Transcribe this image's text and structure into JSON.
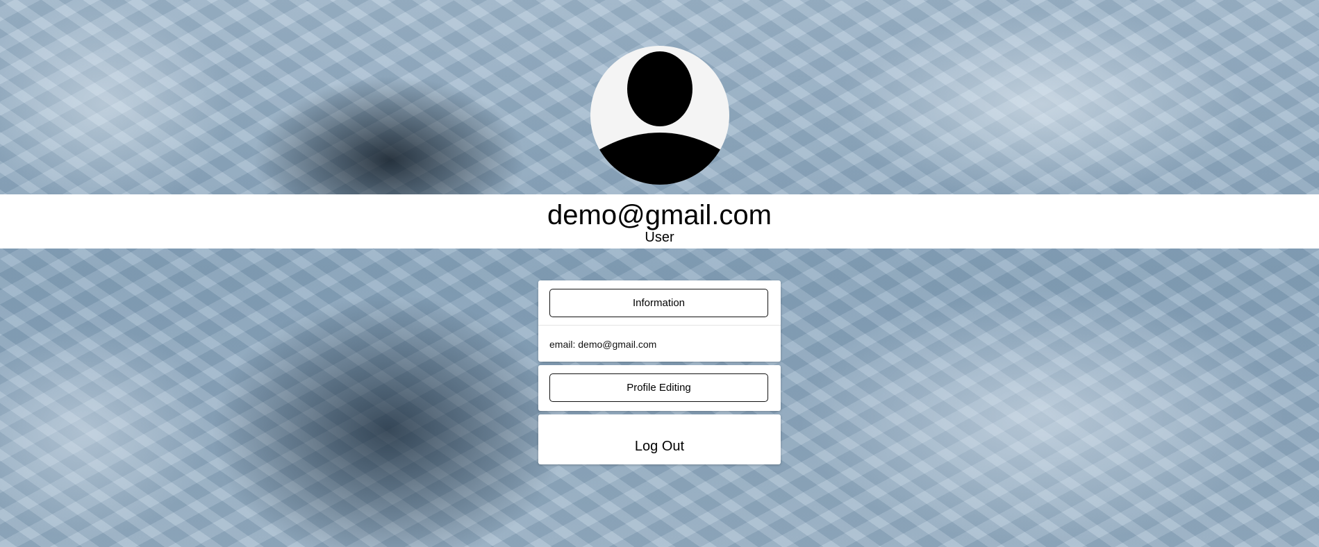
{
  "profile": {
    "email": "demo@gmail.com",
    "role": "User",
    "avatar_icon": "user-silhouette-icon"
  },
  "information": {
    "button_label": "Information",
    "email_label": "email:",
    "email_value": "demo@gmail.com"
  },
  "profile_editing": {
    "button_label": "Profile Editing"
  },
  "logout": {
    "label": "Log Out"
  },
  "colors": {
    "card_background": "#ffffff",
    "band_background": "#ffffff",
    "text": "#000000"
  }
}
